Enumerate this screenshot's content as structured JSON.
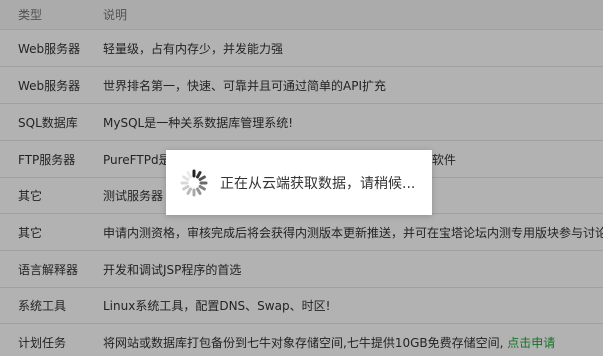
{
  "table": {
    "headers": {
      "type": "类型",
      "desc": "说明"
    },
    "rows": [
      {
        "type": "Web服务器",
        "desc": "轻量级，占有内存少，并发能力强"
      },
      {
        "type": "Web服务器",
        "desc": "世界排名第一，快速、可靠并且可通过简单的API扩充"
      },
      {
        "type": "SQL数据库",
        "desc": "MySQL是一种关系数据库管理系统!"
      },
      {
        "type": "FTP服务器",
        "desc": "PureFTPd是一款专注于程序健壮和软件安全的免费FTP服务器软件"
      },
      {
        "type": "其它",
        "desc": "测试服务器"
      },
      {
        "type": "其它",
        "desc": "申请内测资格，审核完成后将会获得内测版本更新推送，并可在宝塔论坛内测专用版块参与讨论"
      },
      {
        "type": "语言解释器",
        "desc": "开发和调试JSP程序的首选"
      },
      {
        "type": "系统工具",
        "desc": "Linux系统工具，配置DNS、Swap、时区!"
      },
      {
        "type": "计划任务",
        "desc": "将网站或数据库打包备份到七牛对象存储空间,七牛提供10GB免费存储空间, ",
        "link": "点击申请"
      }
    ]
  },
  "loading": {
    "text": "正在从云端获取数据，请稍候..."
  },
  "colors": {
    "overlay": "rgba(0,0,0,0.30)",
    "link": "#20a53a"
  }
}
